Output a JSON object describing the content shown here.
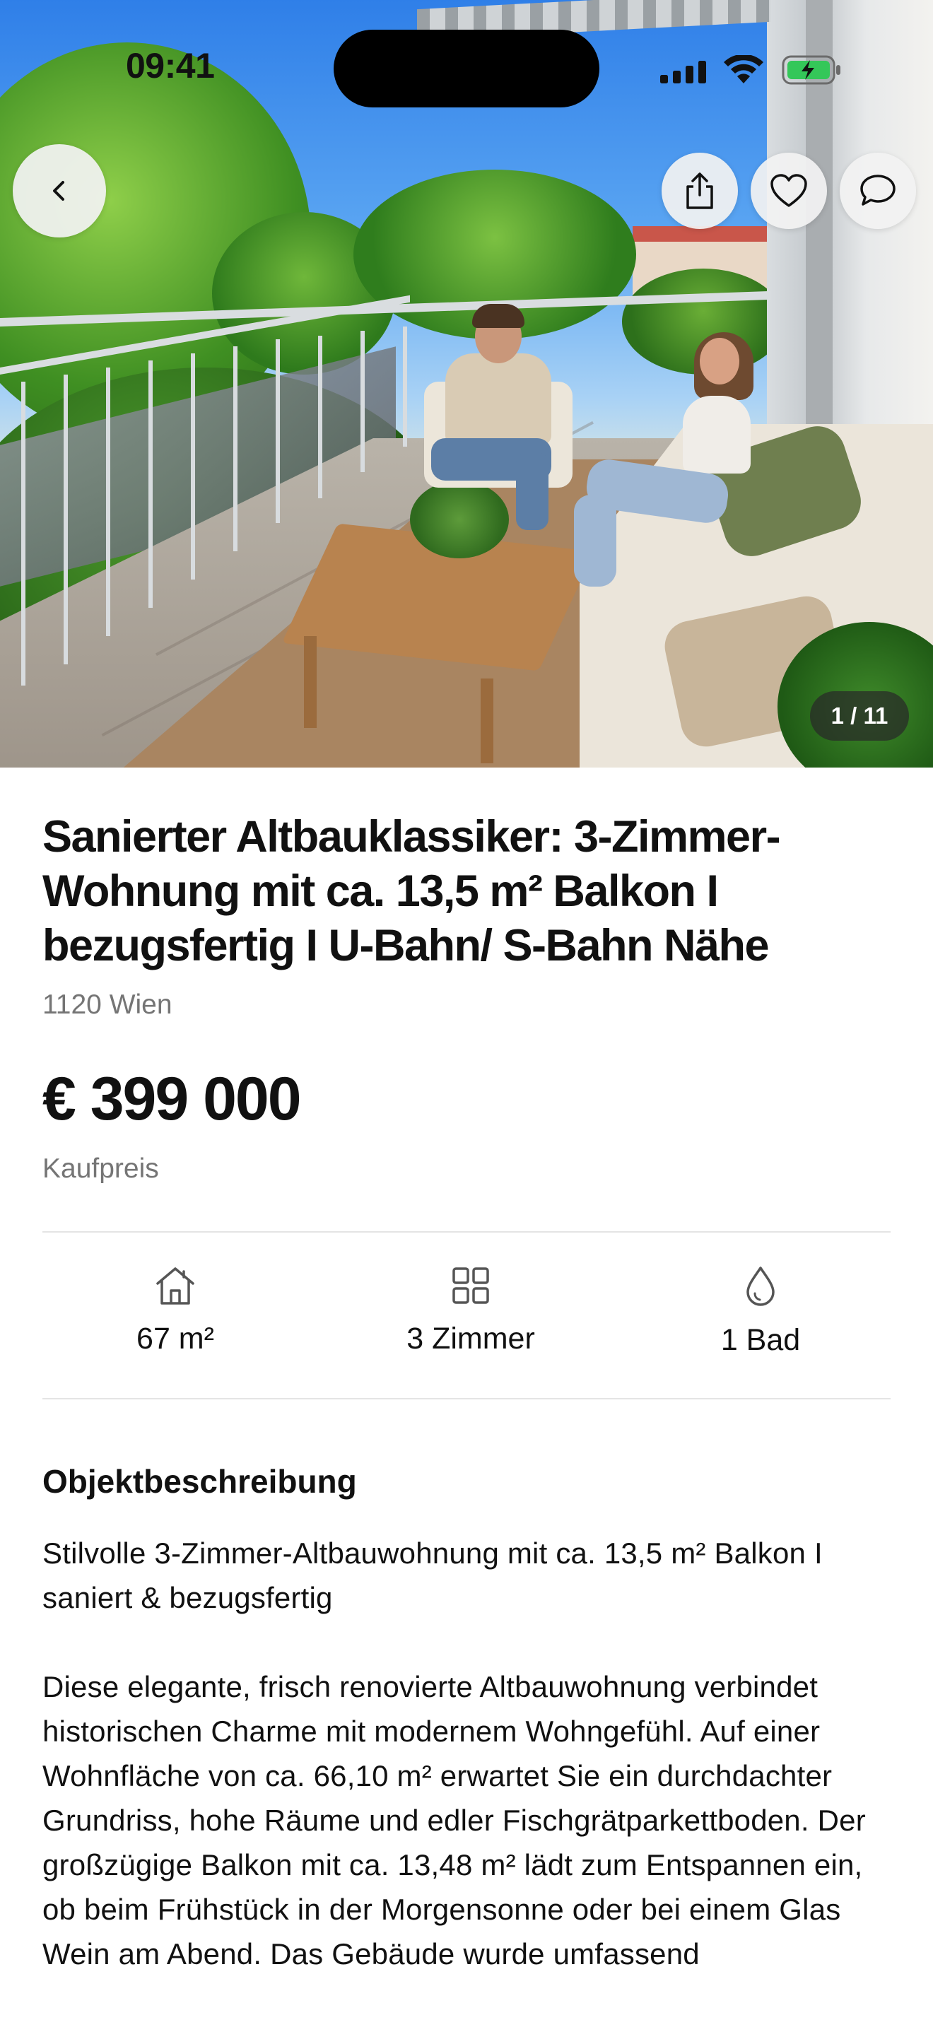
{
  "status_bar": {
    "time": "09:41",
    "icons": [
      "cellular-signal-icon",
      "wifi-icon",
      "battery-charging-icon"
    ],
    "battery_color": "#34c759"
  },
  "hero": {
    "photo_counter": "1 / 11",
    "buttons": [
      "back-chevron-icon",
      "share-icon",
      "heart-icon",
      "chat-bubble-icon"
    ]
  },
  "listing": {
    "title": "Sanierter Altbauklassiker: 3-Zimmer-Wohnung mit ca. 13,5 m² Balkon I bezugsfertig I U-Bahn/ S-Bahn Nähe",
    "location": "1120 Wien",
    "price": "€ 399 000",
    "price_label": "Kaufpreis"
  },
  "facts": [
    {
      "icon": "house-icon",
      "label": "67 m²"
    },
    {
      "icon": "rooms-grid-icon",
      "label": "3 Zimmer"
    },
    {
      "icon": "water-drop-icon",
      "label": "1 Bad"
    }
  ],
  "description": {
    "heading": "Objektbeschreibung",
    "intro": "Stilvolle 3-Zimmer-Altbauwohnung mit ca. 13,5 m² Balkon I saniert & bezugsfertig",
    "body": "Diese elegante, frisch renovierte Altbauwohnung verbindet historischen Charme mit modernem Wohngefühl. Auf einer Wohnfläche von ca. 66,10 m² erwartet Sie ein durchdachter Grundriss, hohe Räume und edler Fischgrätparkettboden. Der großzügige Balkon mit ca. 13,48 m² lädt zum Entspannen ein, ob beim Frühstück in der Morgensonne oder bei einem Glas Wein am Abend. Das Gebäude wurde umfassend"
  },
  "colors": {
    "text_primary": "#111111",
    "text_secondary": "#757575",
    "divider": "#e4e4e4"
  }
}
